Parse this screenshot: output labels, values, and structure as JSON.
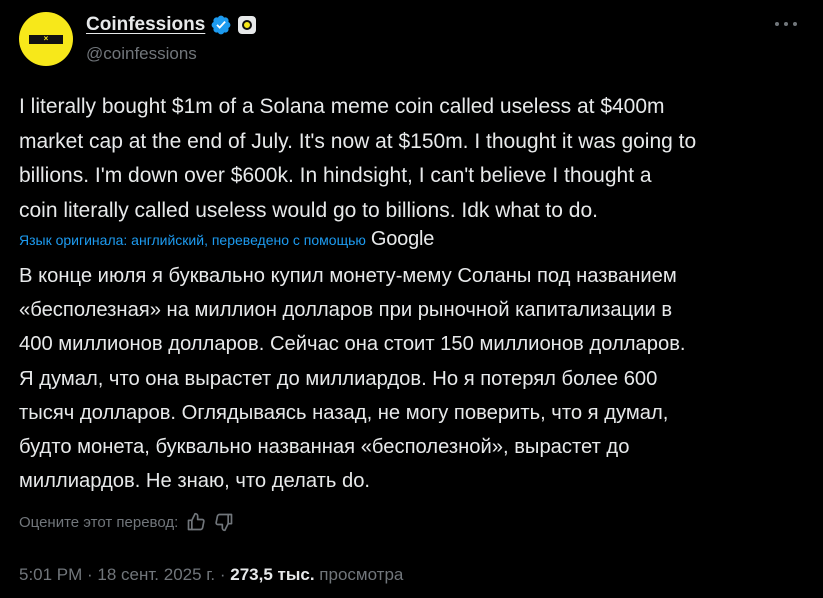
{
  "account": {
    "display_name": "Coinfessions",
    "handle": "@coinfessions",
    "avatar_mark": "×"
  },
  "tweet": {
    "text": "I literally bought $1m of a Solana meme coin called useless at $400m\nmarket cap at the end of July. It's now at $150m. I thought it was going to\nbillions. I'm down over $600k. In hindsight, I can't believe I thought a\ncoin literally called useless would go to billions. Idk what to do.",
    "translation_label": "Язык оригинала: английский, переведено с помощью",
    "translation_provider": "Google",
    "translated_text": "В конце июля я буквально купил монету-мему Соланы под названием\n«бесполезная» на миллион долларов при рыночной капитализации в\n400 миллионов долларов. Сейчас она стоит 150 миллионов долларов.\nЯ думал, что она вырастет до миллиардов. Но я потерял более 600\nтысяч долларов. Оглядываясь назад, не могу поверить, что я думал,\nбудто монета, буквально названная «бесполезной», вырастет до\nмиллиардов. Не знаю, что делать do.",
    "rate_label": "Оцените этот перевод:",
    "time": "5:01 PM",
    "separator": " · ",
    "date": "18 сент. 2025 г.",
    "views_count": "273,5 тыс.",
    "views_label": "просмотра"
  },
  "colors": {
    "background": "#000000",
    "text": "#e7e9ea",
    "muted": "#71767b",
    "link": "#1d9bf0",
    "verified": "#1d9bf0",
    "avatar": "#f7e81a"
  },
  "icons": [
    "verified-badge-icon",
    "affiliate-badge-icon",
    "more-options-icon",
    "thumbs-up-icon",
    "thumbs-down-icon"
  ]
}
